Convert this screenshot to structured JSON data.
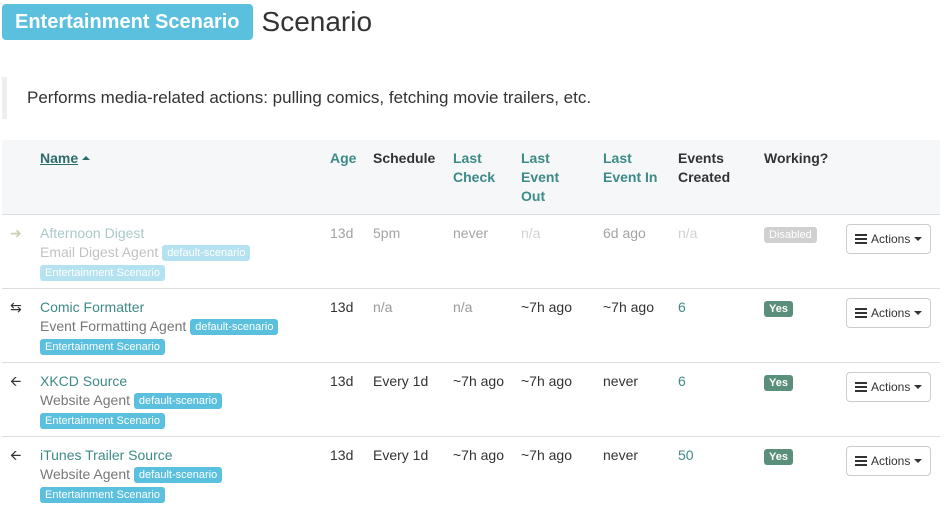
{
  "header": {
    "scenario_name": "Entertainment Scenario",
    "title": "Scenario"
  },
  "description": "Performs media-related actions: pulling comics, fetching movie trailers, etc.",
  "table": {
    "columns": {
      "name": "Name",
      "age": "Age",
      "schedule": "Schedule",
      "last_check_1": "Last",
      "last_check_2": "Check",
      "last_event_out_1": "Last",
      "last_event_out_2": "Event",
      "last_event_out_3": "Out",
      "last_event_in_1": "Last",
      "last_event_in_2": "Event In",
      "events_created_1": "Events",
      "events_created_2": "Created",
      "working": "Working?"
    },
    "rows": [
      {
        "icon": "arrow-right-icon",
        "name": "Afternoon Digest",
        "type": "Email Digest Agent",
        "tag": "default-scenario",
        "scenario": "Entertainment Scenario",
        "age": "13d",
        "schedule": "5pm",
        "last_check": "never",
        "last_event_out": "n/a",
        "last_event_in": "6d ago",
        "events_created": "n/a",
        "working": "Disabled",
        "actions": "Actions"
      },
      {
        "icon": "exchange-icon",
        "name": "Comic Formatter",
        "type": "Event Formatting Agent",
        "tag": "default-scenario",
        "scenario": "Entertainment Scenario",
        "age": "13d",
        "schedule": "n/a",
        "last_check": "n/a",
        "last_event_out": "~7h ago",
        "last_event_in": "~7h ago",
        "events_created": "6",
        "working": "Yes",
        "actions": "Actions"
      },
      {
        "icon": "arrow-left-icon",
        "name": "XKCD Source",
        "type": "Website Agent",
        "tag": "default-scenario",
        "scenario": "Entertainment Scenario",
        "age": "13d",
        "schedule": "Every 1d",
        "last_check": "~7h ago",
        "last_event_out": "~7h ago",
        "last_event_in": "never",
        "events_created": "6",
        "working": "Yes",
        "actions": "Actions"
      },
      {
        "icon": "arrow-left-icon",
        "name": "iTunes Trailer Source",
        "type": "Website Agent",
        "tag": "default-scenario",
        "scenario": "Entertainment Scenario",
        "age": "13d",
        "schedule": "Every 1d",
        "last_check": "~7h ago",
        "last_event_out": "~7h ago",
        "last_event_in": "never",
        "events_created": "50",
        "working": "Yes",
        "actions": "Actions"
      }
    ]
  },
  "colors": {
    "info": "#5bc0de",
    "link": "#3d8a87",
    "success": "#5a8f7b"
  }
}
